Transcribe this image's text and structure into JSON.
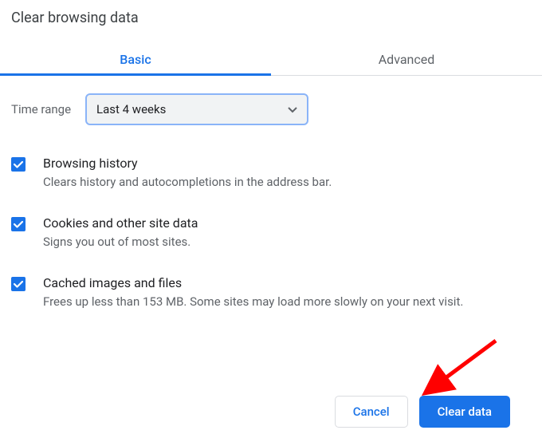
{
  "dialog": {
    "title": "Clear browsing data"
  },
  "tabs": {
    "basic": "Basic",
    "advanced": "Advanced"
  },
  "time_range": {
    "label": "Time range",
    "selected": "Last 4 weeks"
  },
  "options": [
    {
      "title": "Browsing history",
      "description": "Clears history and autocompletions in the address bar."
    },
    {
      "title": "Cookies and other site data",
      "description": "Signs you out of most sites."
    },
    {
      "title": "Cached images and files",
      "description": "Frees up less than 153 MB. Some sites may load more slowly on your next visit."
    }
  ],
  "buttons": {
    "cancel": "Cancel",
    "clear": "Clear data"
  }
}
